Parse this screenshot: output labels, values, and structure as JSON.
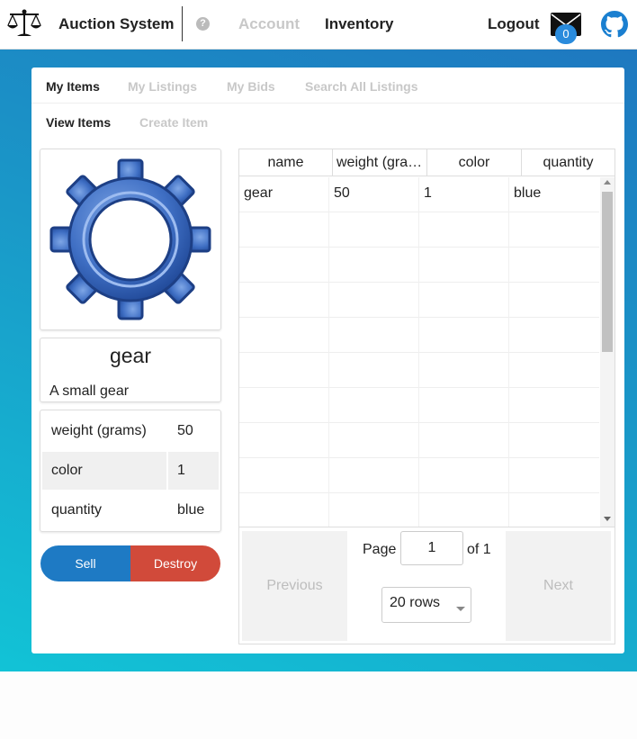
{
  "navbar": {
    "title": "Auction System",
    "help_glyph": "?",
    "account": "Account",
    "inventory": "Inventory",
    "logout": "Logout",
    "mail_count": "0",
    "icons": [
      "scales-logo-icon",
      "help-icon",
      "mail-icon",
      "github-icon"
    ]
  },
  "tabs": [
    "My Items",
    "My Listings",
    "My Bids",
    "Search All Listings"
  ],
  "subtabs": [
    "View Items",
    "Create Item"
  ],
  "item": {
    "name": "gear",
    "description": "A small gear",
    "image_icon": "gear-icon",
    "properties": [
      {
        "key": "weight (grams)",
        "value": "50"
      },
      {
        "key": "color",
        "value": "1"
      },
      {
        "key": "quantity",
        "value": "blue"
      }
    ]
  },
  "actions": {
    "sell": "Sell",
    "destroy": "Destroy"
  },
  "grid": {
    "columns": [
      "name",
      "weight (grams)",
      "color",
      "quantity"
    ],
    "rows": [
      [
        "gear",
        "50",
        "1",
        "blue"
      ]
    ]
  },
  "pager": {
    "previous": "Previous",
    "next": "Next",
    "page_label": "Page",
    "page_value": "1",
    "of_label": "of 1",
    "rows_option": "20 rows"
  },
  "colors": {
    "primary": "#1e7ac4",
    "danger": "#d14a3a",
    "badge": "#2a8bdc",
    "gradient_top": "#1e78c0",
    "gradient_bottom": "#12c3d6"
  }
}
